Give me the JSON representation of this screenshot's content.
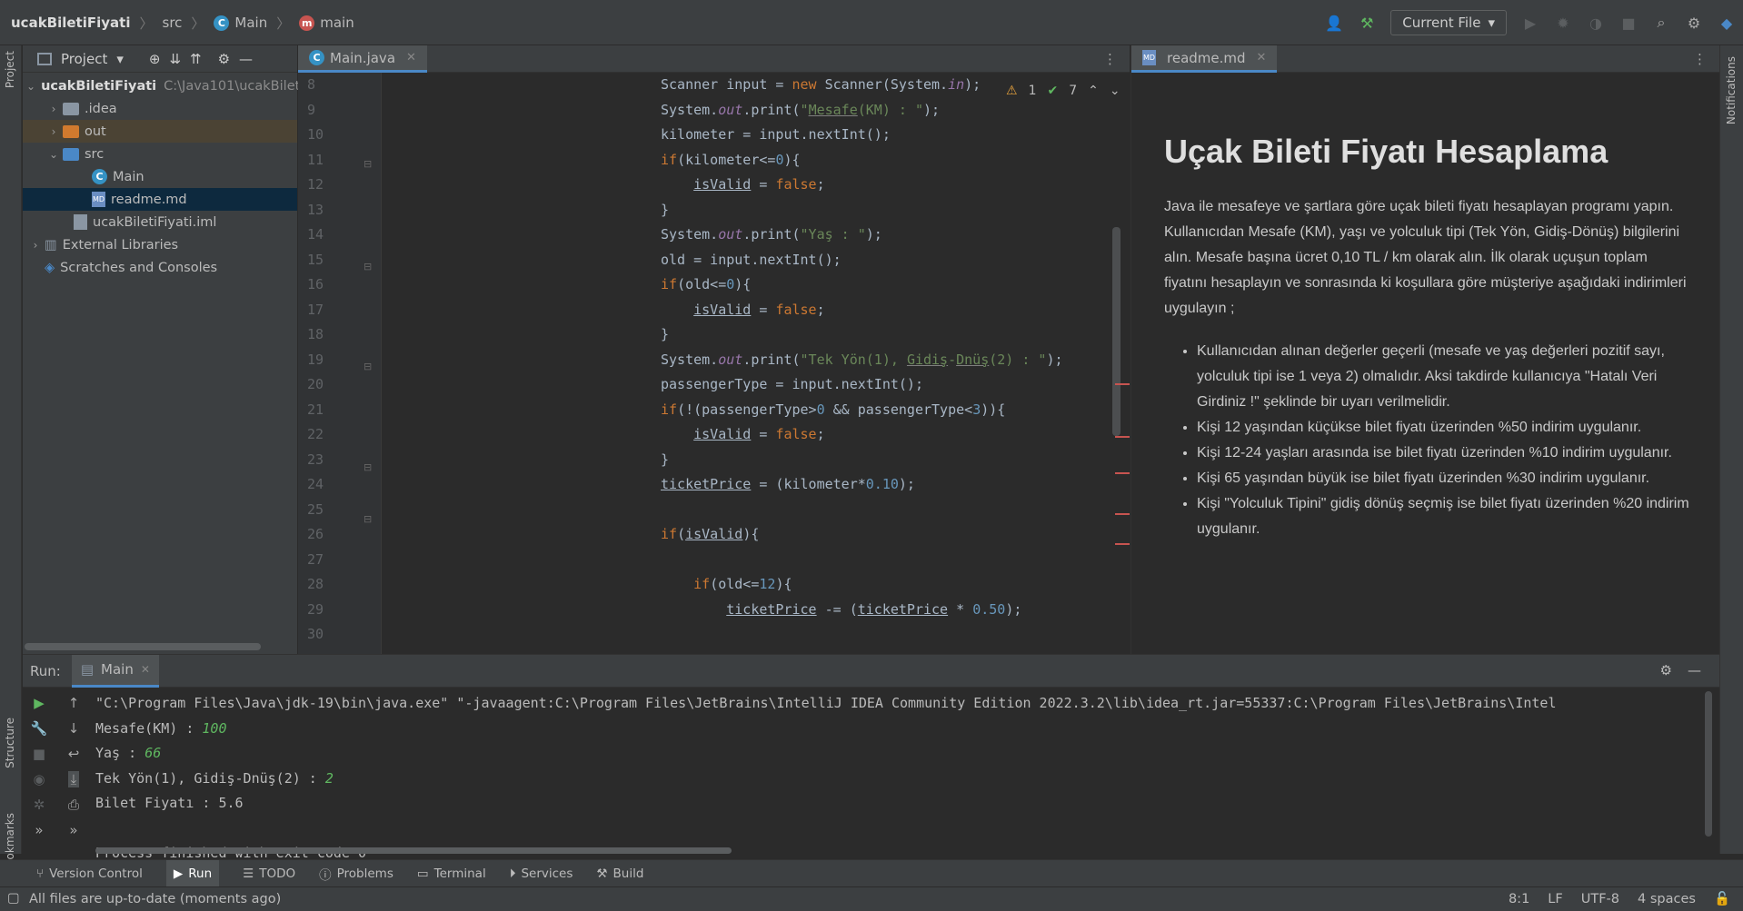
{
  "navbar": {
    "project": "ucakBiletiFiyati",
    "src": "src",
    "class": "Main",
    "method": "main",
    "run_config": "Current File"
  },
  "left_strip": {
    "project": "Project",
    "structure": "Structure",
    "bookmarks": "Bookmarks"
  },
  "project_panel": {
    "title": "Project",
    "items": [
      {
        "label": "ucakBiletiFiyati",
        "path": "C:\\Java101\\ucakBilet"
      },
      {
        "label": ".idea"
      },
      {
        "label": "out"
      },
      {
        "label": "src"
      },
      {
        "label": "Main"
      },
      {
        "label": "readme.md"
      },
      {
        "label": "ucakBiletiFiyati.iml"
      },
      {
        "label": "External Libraries"
      },
      {
        "label": "Scratches and Consoles"
      }
    ]
  },
  "editor": {
    "tab_label": "Main.java",
    "warnings": "1",
    "checks": "7",
    "line_numbers": [
      "8",
      "9",
      "10",
      "11",
      "12",
      "13",
      "14",
      "15",
      "16",
      "17",
      "18",
      "19",
      "20",
      "21",
      "22",
      "23",
      "24",
      "25",
      "26",
      "27",
      "28",
      "29",
      "30"
    ]
  },
  "preview": {
    "tab_label": "readme.md",
    "title": "Uçak Bileti Fiyatı Hesaplama",
    "intro": "Java ile mesafeye ve şartlara göre uçak bileti fiyatı hesaplayan programı yapın. Kullanıcıdan Mesafe (KM), yaşı ve yolculuk tipi (Tek Yön, Gidiş-Dönüş) bilgilerini alın. Mesafe başına ücret 0,10 TL / km olarak alın. İlk olarak uçuşun toplam fiyatını hesaplayın ve sonrasında ki koşullara göre müşteriye aşağıdaki indirimleri uygulayın ;",
    "bullets": [
      "Kullanıcıdan alınan değerler geçerli (mesafe ve yaş değerleri pozitif sayı, yolculuk tipi ise 1 veya 2) olmalıdır. Aksi takdirde kullanıcıya \"Hatalı Veri Girdiniz !\" şeklinde bir uyarı verilmelidir.",
      "Kişi 12 yaşından küçükse bilet fiyatı üzerinden %50 indirim uygulanır.",
      "Kişi 12-24 yaşları arasında ise bilet fiyatı üzerinden %10 indirim uygulanır.",
      "Kişi 65 yaşından büyük ise bilet fiyatı üzerinden %30 indirim uygulanır.",
      "Kişi \"Yolculuk Tipini\" gidiş dönüş seçmiş ise bilet fiyatı üzerinden %20 indirim uygulanır."
    ]
  },
  "run": {
    "label": "Run:",
    "tab": "Main",
    "console": {
      "cmd": "\"C:\\Program Files\\Java\\jdk-19\\bin\\java.exe\" \"-javaagent:C:\\Program Files\\JetBrains\\IntelliJ IDEA Community Edition 2022.3.2\\lib\\idea_rt.jar=55337:C:\\Program Files\\JetBrains\\Intel",
      "p1": "Mesafe(KM) : ",
      "v1": "100",
      "p2": "Yaş : ",
      "v2": "66",
      "p3": "Tek Yön(1), Gidiş-Dnüş(2) : ",
      "v3": "2",
      "result": "Bilet Fiyatı : 5.6",
      "exit": "Process finished with exit code 0"
    }
  },
  "tool_tabs": [
    "Version Control",
    "Run",
    "TODO",
    "Problems",
    "Terminal",
    "Services",
    "Build"
  ],
  "status": {
    "message": "All files are up-to-date (moments ago)",
    "position": "8:1",
    "line_sep": "LF",
    "encoding": "UTF-8",
    "indent": "4 spaces"
  },
  "right_strip": {
    "notifications": "Notifications"
  }
}
